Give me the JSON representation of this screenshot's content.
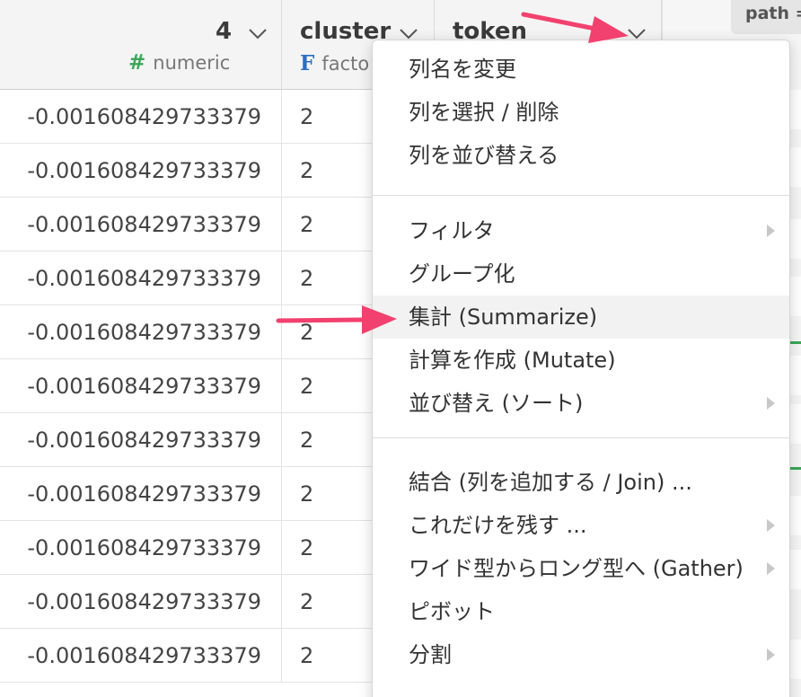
{
  "columns": [
    {
      "title": "4",
      "type_label": "numeric",
      "type_icon": "#"
    },
    {
      "title": "cluster",
      "type_label": "facto",
      "type_icon": "F"
    },
    {
      "title": "token",
      "type_label": "",
      "type_icon": ""
    }
  ],
  "rows": [
    {
      "c4": "-0.001608429733379",
      "cluster": "2"
    },
    {
      "c4": "-0.001608429733379",
      "cluster": "2"
    },
    {
      "c4": "-0.001608429733379",
      "cluster": "2"
    },
    {
      "c4": "-0.001608429733379",
      "cluster": "2"
    },
    {
      "c4": "-0.001608429733379",
      "cluster": "2"
    },
    {
      "c4": "-0.001608429733379",
      "cluster": "2"
    },
    {
      "c4": "-0.001608429733379",
      "cluster": "2"
    },
    {
      "c4": "-0.001608429733379",
      "cluster": "2"
    },
    {
      "c4": "-0.001608429733379",
      "cluster": "2"
    },
    {
      "c4": "-0.001608429733379",
      "cluster": "2"
    },
    {
      "c4": "-0.001608429733379",
      "cluster": "2"
    }
  ],
  "side_panel": {
    "path_label": "path ="
  },
  "menu": {
    "groups": [
      [
        {
          "label": "列名を変更",
          "submenu": false
        },
        {
          "label": "列を選択 / 削除",
          "submenu": false
        },
        {
          "label": "列を並び替える",
          "submenu": false
        }
      ],
      [
        {
          "label": "フィルタ",
          "submenu": true
        },
        {
          "label": "グループ化",
          "submenu": false
        },
        {
          "label": "集計 (Summarize)",
          "submenu": false,
          "highlighted": true
        },
        {
          "label": "計算を作成 (Mutate)",
          "submenu": false
        },
        {
          "label": "並び替え (ソート)",
          "submenu": true
        }
      ],
      [
        {
          "label": "結合 (列を追加する / Join) ...",
          "submenu": false
        },
        {
          "label": "これだけを残す ...",
          "submenu": true
        },
        {
          "label": "ワイド型からロング型へ (Gather)",
          "submenu": true
        },
        {
          "label": "ピボット",
          "submenu": false
        },
        {
          "label": "分割",
          "submenu": true
        }
      ]
    ]
  },
  "colors": {
    "accent_arrow": "#f2416e",
    "numeric_icon": "#3aa757",
    "factor_icon": "#2c6fbf",
    "highlight": "#f2f2f2"
  }
}
